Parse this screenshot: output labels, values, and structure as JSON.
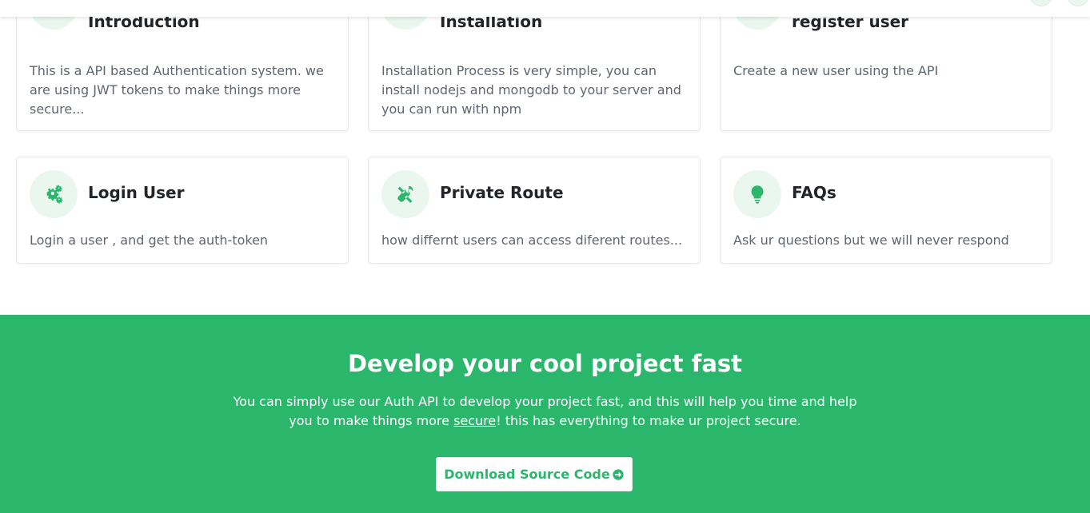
{
  "colors": {
    "accent": "#2bb66b",
    "cta_background": "#2bb76b",
    "icon_background": "#e9f7ef"
  },
  "cards": [
    {
      "icon": "signpost-icon",
      "title": "Introduction",
      "description": "This is a API based Authentication system. we are using JWT tokens to make things more secure..."
    },
    {
      "icon": "download-arrow-icon",
      "title": "Installation",
      "description": "Installation Process is very simple, you can install nodejs and mongodb to your server and you can run with npm"
    },
    {
      "icon": "box-icon",
      "title": "register user",
      "description": "Create a new user using the API"
    },
    {
      "icon": "gears-icon",
      "title": "Login User",
      "description": "Login a user , and get the auth-token"
    },
    {
      "icon": "tools-icon",
      "title": "Private Route",
      "description": "how differnt users can access diferent routes..."
    },
    {
      "icon": "lightbulb-icon",
      "title": "FAQs",
      "description": "Ask ur questions but we will never respond"
    }
  ],
  "cta": {
    "title": "Develop your cool project fast",
    "text_before": "You can simply use our Auth API to develop your project fast, and this will help you time and help you to make things more ",
    "text_link": "secure",
    "text_after": "! this has everything to make ur project secure.",
    "button_label": "Download Source Code",
    "button_icon": "arrow-circle-right-icon"
  }
}
